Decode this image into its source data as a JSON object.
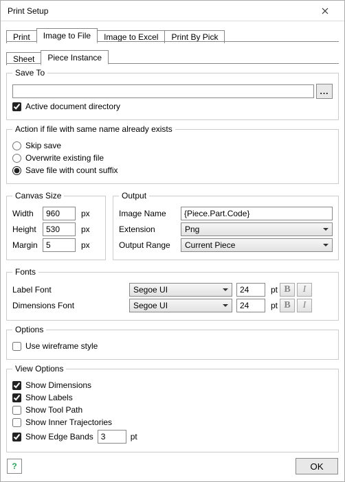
{
  "window": {
    "title": "Print Setup"
  },
  "tabs": {
    "main": [
      "Print",
      "Image to File",
      "Image to Excel",
      "Print By Pick"
    ],
    "activeMain": "Image to File",
    "sub": [
      "Sheet",
      "Piece Instance"
    ],
    "activeSub": "Piece Instance"
  },
  "saveTo": {
    "legend": "Save To",
    "path": "",
    "browse": "...",
    "activeDocDir": {
      "label": "Active document directory",
      "checked": true
    }
  },
  "conflict": {
    "legend": "Action if file with same name already exists",
    "options": {
      "skip": {
        "label": "Skip save",
        "selected": false
      },
      "overwrite": {
        "label": "Overwrite existing file",
        "selected": false
      },
      "suffix": {
        "label": "Save file with count suffix",
        "selected": true
      }
    }
  },
  "canvas": {
    "legend": "Canvas Size",
    "widthLabel": "Width",
    "width": "960",
    "heightLabel": "Height",
    "height": "530",
    "marginLabel": "Margin",
    "margin": "5",
    "unit": "px"
  },
  "output": {
    "legend": "Output",
    "imageNameLabel": "Image Name",
    "imageName": "{Piece.Part.Code}",
    "extensionLabel": "Extension",
    "extension": "Png",
    "rangeLabel": "Output Range",
    "range": "Current Piece"
  },
  "fonts": {
    "legend": "Fonts",
    "labelFontLabel": "Label Font",
    "dimFontLabel": "Dimensions Font",
    "labelFont": "Segoe UI",
    "labelSize": "24",
    "dimFont": "Segoe UI",
    "dimSize": "24",
    "ptUnit": "pt",
    "boldGlyph": "B",
    "italicGlyph": "I"
  },
  "options": {
    "legend": "Options",
    "wireframe": {
      "label": "Use wireframe style",
      "checked": false
    }
  },
  "view": {
    "legend": "View Options",
    "showDimensions": {
      "label": "Show Dimensions",
      "checked": true
    },
    "showLabels": {
      "label": "Show Labels",
      "checked": true
    },
    "showToolPath": {
      "label": "Show Tool Path",
      "checked": false
    },
    "showInnerTraj": {
      "label": "Show Inner Trajectories",
      "checked": false
    },
    "showEdgeBands": {
      "label": "Show Edge Bands",
      "checked": true,
      "value": "3",
      "unit": "pt"
    }
  },
  "buttons": {
    "ok": "OK",
    "help": "?"
  }
}
